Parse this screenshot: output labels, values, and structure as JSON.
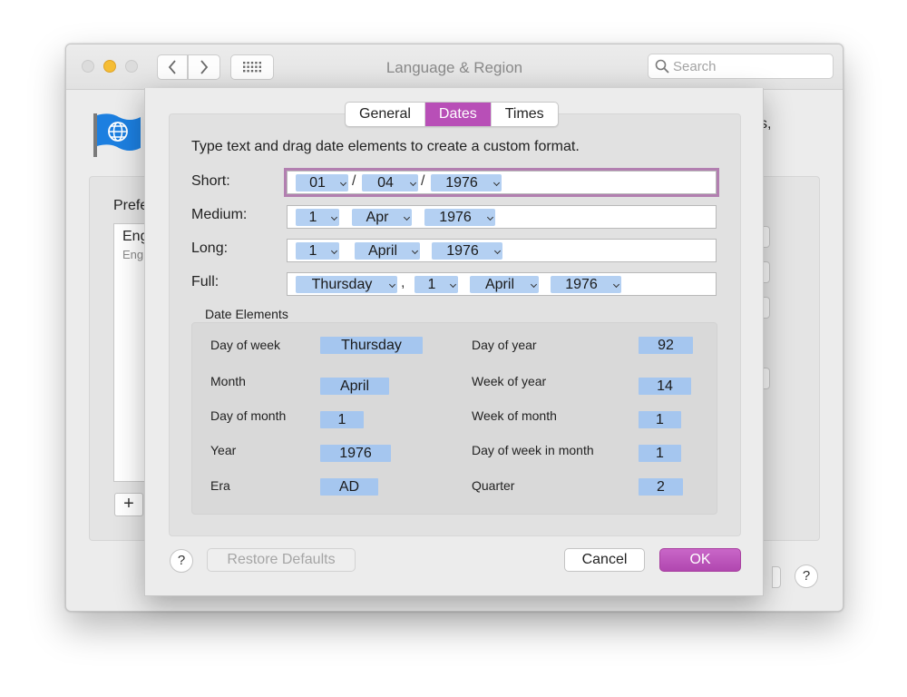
{
  "window": {
    "title": "Language & Region",
    "search_placeholder": "Search"
  },
  "background": {
    "preferred_label": "Prefe",
    "list_item_main": "Eng",
    "list_item_sub": "Eng",
    "trailing_text": "s,",
    "add_button": "+",
    "help_button": "?"
  },
  "sheet": {
    "tabs": [
      {
        "label": "General",
        "active": false
      },
      {
        "label": "Dates",
        "active": true
      },
      {
        "label": "Times",
        "active": false
      }
    ],
    "instruction": "Type text and drag date elements to create a custom format.",
    "formats": {
      "short": {
        "label": "Short:",
        "tokens": [
          "01",
          "04",
          "1976"
        ],
        "separators": [
          "/",
          "/"
        ]
      },
      "medium": {
        "label": "Medium:",
        "tokens": [
          "1",
          "Apr",
          "1976"
        ]
      },
      "long": {
        "label": "Long:",
        "tokens": [
          "1",
          "April",
          "1976"
        ]
      },
      "full": {
        "label": "Full:",
        "tokens": [
          "Thursday",
          "1",
          "April",
          "1976"
        ],
        "separators": [
          ","
        ]
      }
    },
    "date_elements": {
      "title": "Date Elements",
      "left": [
        {
          "label": "Day of week",
          "value": "Thursday"
        },
        {
          "label": "Month",
          "value": "April"
        },
        {
          "label": "Day of month",
          "value": "1"
        },
        {
          "label": "Year",
          "value": "1976"
        },
        {
          "label": "Era",
          "value": "AD"
        }
      ],
      "right": [
        {
          "label": "Day of year",
          "value": "92"
        },
        {
          "label": "Week of year",
          "value": "14"
        },
        {
          "label": "Week of month",
          "value": "1"
        },
        {
          "label": "Day of week in month",
          "value": "1"
        },
        {
          "label": "Quarter",
          "value": "2"
        }
      ]
    },
    "buttons": {
      "help": "?",
      "restore": "Restore Defaults",
      "cancel": "Cancel",
      "ok": "OK"
    }
  },
  "colors": {
    "accent": "#b84fb7",
    "token": "#b4d0f2",
    "element_token": "#a5c6ef",
    "minimize": "#f5bd35"
  },
  "icons": [
    "chevron-left-icon",
    "chevron-right-icon",
    "grid-icon",
    "search-icon",
    "globe-flag-icon"
  ]
}
